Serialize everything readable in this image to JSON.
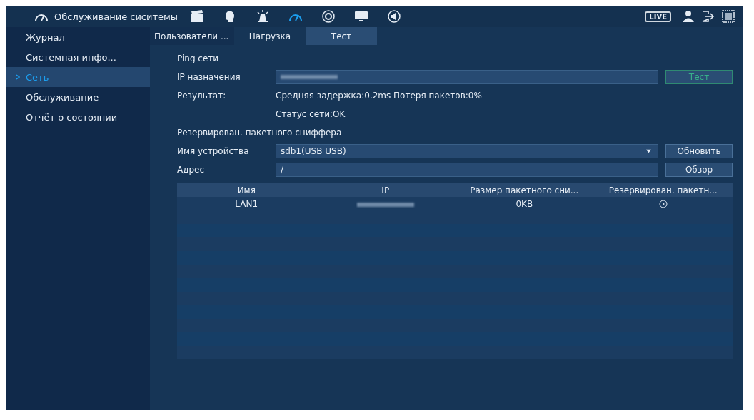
{
  "top_bar": {
    "title": "Обслуживание сиситемы",
    "icons": [
      {
        "kind": "clapper",
        "selected": false
      },
      {
        "kind": "head",
        "selected": false
      },
      {
        "kind": "alarm",
        "selected": false
      },
      {
        "kind": "gauge",
        "selected": true
      },
      {
        "kind": "sync",
        "selected": false
      },
      {
        "kind": "monitor",
        "selected": false
      },
      {
        "kind": "speaker",
        "selected": false
      }
    ],
    "live": "LIVE"
  },
  "sidebar": {
    "items": [
      {
        "label": "Журнал",
        "selected": false
      },
      {
        "label": "Системная инфо...",
        "selected": false
      },
      {
        "label": "Сеть",
        "selected": true
      },
      {
        "label": "Обслуживание",
        "selected": false
      },
      {
        "label": "Отчёт о состоянии",
        "selected": false
      }
    ]
  },
  "tabs": [
    {
      "label": "Пользователи ...",
      "selected": false
    },
    {
      "label": "Нагрузка",
      "selected": false
    },
    {
      "label": "Тест",
      "selected": true
    }
  ],
  "ping": {
    "heading": "Ping сети",
    "ip_label": "IP назначения",
    "test_button": "Тест",
    "result_label": "Результат:",
    "result": "Средняя задержка:0.2ms  Потеря пакетов:0%",
    "status": "Статус сети:OK"
  },
  "sniffer": {
    "heading": "Резервирован. пакетного сниффера",
    "device_label": "Имя устройства",
    "device_value": "sdb1(USB USB)",
    "refresh_button": "Обновить",
    "address_label": "Адрес",
    "address_value": "/",
    "browse_button": "Обзор",
    "table": {
      "columns": [
        "Имя",
        "IP",
        "Размер пакетного сни...",
        "Резервирован. пакетн..."
      ],
      "rows": [
        {
          "name": "LAN1",
          "size": "0KB"
        }
      ]
    }
  }
}
